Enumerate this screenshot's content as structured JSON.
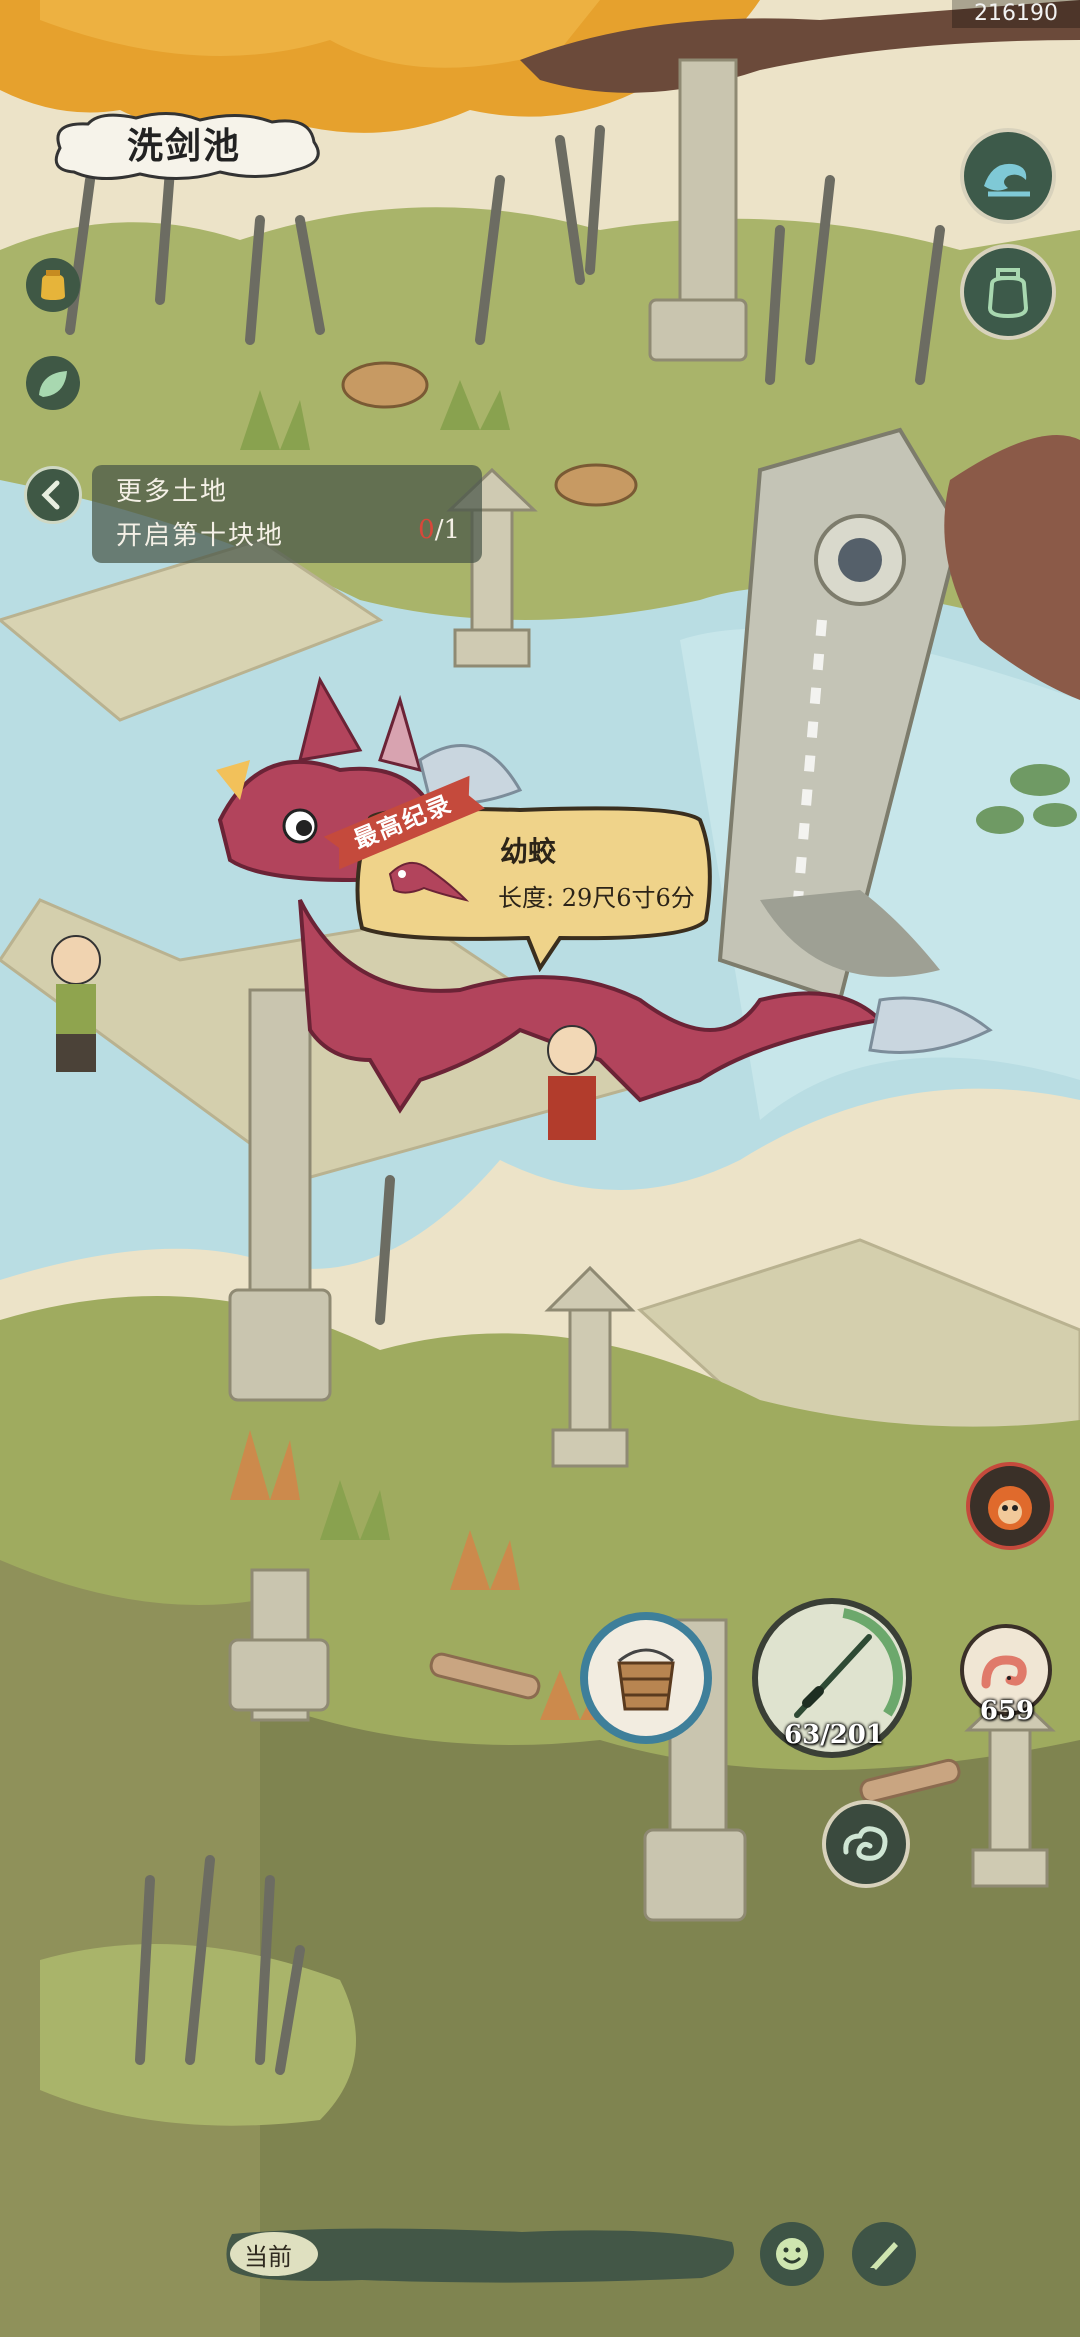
{
  "id_tag": "216190",
  "area_title": "洗剑池",
  "quest": {
    "title": "更多土地",
    "desc": "开启第十块地",
    "progress_current": "0",
    "progress_total": "/1"
  },
  "creature_popup": {
    "record_label": "最高纪录",
    "name": "幼蛟",
    "length": "长度: 29尺6寸6分"
  },
  "hud": {
    "rod_count": "63/201",
    "bait_count": "659"
  },
  "bottom_bar": {
    "label": "当前"
  },
  "icons": [
    "wave-icon",
    "jar-icon",
    "honey-jar-icon",
    "leaf-icon",
    "chevron-left-icon",
    "bucket-icon",
    "fishing-rod-icon",
    "worm-icon",
    "cloud-swirl-icon",
    "monkey-king-icon",
    "smile-icon",
    "brush-icon"
  ],
  "colors": {
    "grass": "#a9b46a",
    "water": "#b9dde3",
    "cliff": "#8f915a",
    "dragon": "#b2445c",
    "panel": "#485648",
    "accent_red": "#c54a3c"
  }
}
